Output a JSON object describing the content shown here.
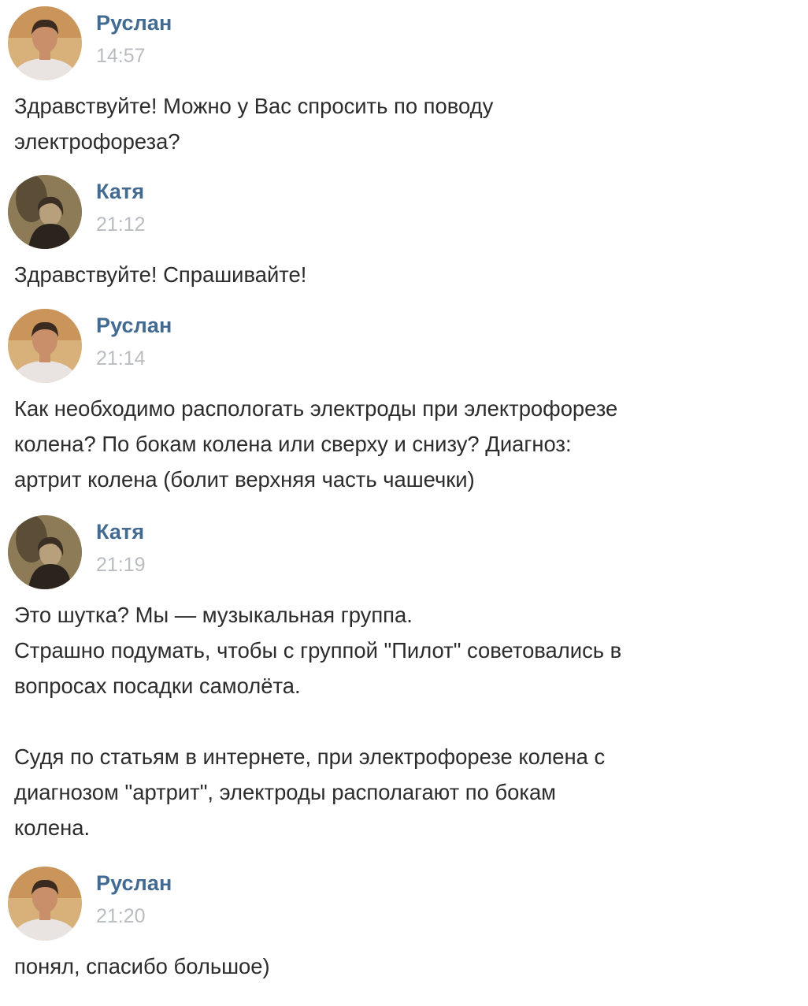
{
  "conversation": {
    "messages": [
      {
        "author": "Руслан",
        "avatar_icon": "user-avatar-ruslan-icon",
        "time": "14:57",
        "lines": [
          "Здравствуйте! Можно у Вас спросить по поводу",
          "электрофореза?"
        ]
      },
      {
        "author": "Катя",
        "avatar_icon": "user-avatar-katya-icon",
        "time": "21:12",
        "lines": [
          "Здравствуйте! Спрашивайте!"
        ]
      },
      {
        "author": "Руслан",
        "avatar_icon": "user-avatar-ruslan-icon",
        "time": "21:14",
        "lines": [
          "Как необходимо распологать электроды при электрофорезе",
          "колена? По бокам колена или сверху и снизу? Диагноз:",
          "артрит колена (болит верхняя часть чашечки)"
        ]
      },
      {
        "author": "Катя",
        "avatar_icon": "user-avatar-katya-icon",
        "time": "21:19",
        "lines": [
          "Это шутка? Мы — музыкальная группа.",
          "Страшно подумать, чтобы с группой \"Пилот\" советовались в",
          "вопросах посадки самолёта.",
          "",
          "Судя по статьям в интернете, при электрофорезе колена с",
          "диагнозом \"артрит\", электроды располагают по бокам",
          "колена."
        ]
      },
      {
        "author": "Руслан",
        "avatar_icon": "user-avatar-ruslan-icon",
        "time": "21:20",
        "lines": [
          "понял, спасибо большое)"
        ]
      }
    ]
  },
  "colors": {
    "author_name": "#426b94",
    "timestamp": "#b9bcc0",
    "message_text": "#2c2c2c",
    "background": "#ffffff"
  }
}
